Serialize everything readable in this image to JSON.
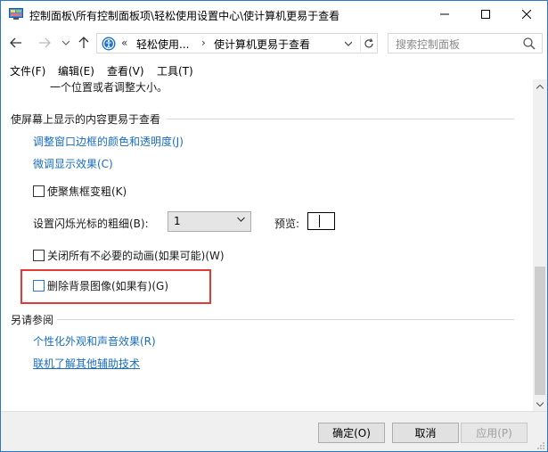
{
  "window": {
    "title": "控制面板\\所有控制面板项\\轻松使用设置中心\\使计算机更易于查看"
  },
  "address": {
    "overflow": "«",
    "crumbs": [
      "轻松使用...",
      "使计算机更易于查看"
    ],
    "separator": "›"
  },
  "search": {
    "placeholder": "搜索控制面板"
  },
  "menu": [
    "文件(F)",
    "编辑(E)",
    "查看(V)",
    "工具(T)"
  ],
  "content": {
    "cutoff_text": "一个位置或者调整大小。",
    "section1": {
      "title": "使屏幕上显示的内容更易于查看",
      "links": [
        "调整窗口边框的颜色和透明度(J)",
        "微调显示效果(C)"
      ],
      "thicken_focus": {
        "label": "使聚焦框变粗(K)",
        "checked": false
      },
      "cursor_width": {
        "label": "设置闪烁光标的粗细(B):",
        "value": "1",
        "preview_label": "预览:"
      },
      "disable_animations": {
        "label": "关闭所有不必要的动画(如果可能)(W)",
        "checked": false
      },
      "remove_background": {
        "label": "删除背景图像(如果有)(G)",
        "checked": false
      }
    },
    "section2": {
      "title": "另请参阅",
      "links": [
        "个性化外观和声音效果(R)",
        "联机了解其他辅助技术"
      ]
    }
  },
  "footer": {
    "ok": "确定(O)",
    "cancel": "取消",
    "apply": "应用(P)"
  },
  "colors": {
    "link": "#1a6dbd",
    "highlight": "#e53935",
    "window_border": "#2b78c6"
  }
}
